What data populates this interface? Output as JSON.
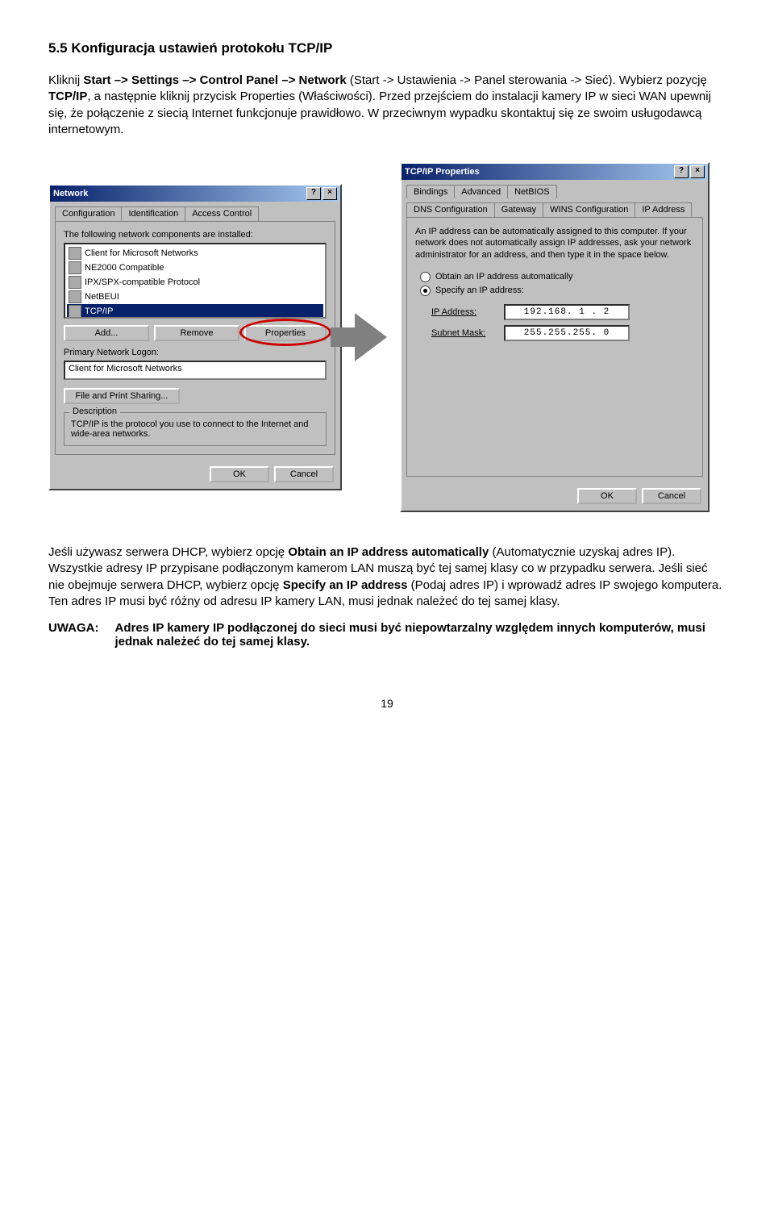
{
  "heading": "5.5 Konfiguracja ustawień protokołu TCP/IP",
  "para1": {
    "pre": "Kliknij ",
    "path": "Start –> Settings –> Control Panel –> Network",
    "post1": " (Start -> Ustawienia -> Panel sterowania -> Sieć). Wybierz pozycję ",
    "tcpip": "TCP/IP",
    "post2": ", a następnie kliknij przycisk Properties (Właściwości). Przed przejściem do instalacji kamery IP w sieci WAN upewnij się, że połączenie z siecią Internet funkcjonuje prawidłowo. W przeciwnym wypadku skontaktuj się ze swoim usługodawcą internetowym."
  },
  "networkDlg": {
    "title": "Network",
    "tabs": [
      "Configuration",
      "Identification",
      "Access Control"
    ],
    "listLabel": "The following network components are installed:",
    "items": [
      "Client for Microsoft Networks",
      "NE2000 Compatible",
      "IPX/SPX-compatible Protocol",
      "NetBEUI",
      "TCP/IP"
    ],
    "buttons": {
      "add": "Add...",
      "remove": "Remove",
      "props": "Properties"
    },
    "primaryLabel": "Primary Network Logon:",
    "primaryValue": "Client for Microsoft Networks",
    "fileBtn": "File and Print Sharing...",
    "descLegend": "Description",
    "descText": "TCP/IP is the protocol you use to connect to the Internet and wide-area networks.",
    "ok": "OK",
    "cancel": "Cancel"
  },
  "tcpDlg": {
    "title": "TCP/IP Properties",
    "tabsTop": [
      "Bindings",
      "Advanced",
      "NetBIOS"
    ],
    "tabsBot": [
      "DNS Configuration",
      "Gateway",
      "WINS Configuration",
      "IP Address"
    ],
    "help": "An IP address can be automatically assigned to this computer. If your network does not automatically assign IP addresses, ask your network administrator for an address, and then type it in the space below.",
    "radioObtain": "Obtain an IP address automatically",
    "radioSpecify": "Specify an IP address:",
    "ipLabel": "IP Address:",
    "ipValue": "192.168.  1 .  2",
    "maskLabel": "Subnet Mask:",
    "maskValue": "255.255.255.  0",
    "ok": "OK",
    "cancel": "Cancel"
  },
  "para2": {
    "pre": "Jeśli używasz serwera DHCP, wybierz opcję ",
    "obtain": "Obtain an IP address automatically",
    "mid1": " (Automatycznie uzyskaj adres IP). Wszystkie adresy IP przypisane podłączonym kamerom LAN muszą być tej samej klasy co w przypadku serwera. Jeśli sieć nie obejmuje serwera DHCP, wybierz opcję ",
    "specify": "Specify an IP address",
    "post": " (Podaj adres IP) i wprowadź adres IP swojego komputera. Ten adres IP musi być różny od adresu IP kamery LAN, musi jednak należeć do tej samej klasy."
  },
  "note": {
    "label": "UWAGA:",
    "text": "Adres IP kamery IP podłączonej do sieci musi być niepowtarzalny względem innych komputerów, musi jednak należeć do tej samej klasy."
  },
  "pageNumber": "19"
}
